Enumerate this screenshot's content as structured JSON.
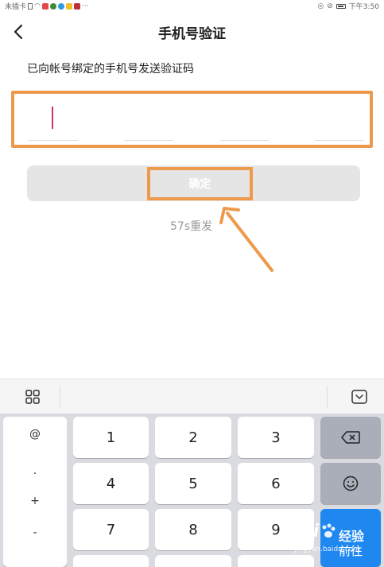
{
  "status_bar": {
    "left_text": "未插卡",
    "right_time": "下午3:50"
  },
  "nav": {
    "title": "手机号验证",
    "back_icon": "chevron-left-icon"
  },
  "hint": "已向帐号绑定的手机号发送验证码",
  "confirm_label": "确定",
  "resend_label": "57s重发",
  "keyboard": {
    "toolbar_icons": [
      "grid-icon",
      "keyboard-hide-icon"
    ],
    "symbols": [
      "@",
      ".",
      "+",
      "-"
    ],
    "digits": [
      "1",
      "2",
      "3",
      "4",
      "5",
      "6",
      "7",
      "8",
      "9"
    ],
    "side_keys": [
      "backspace-icon",
      "emoji-icon"
    ],
    "next_label": "前往"
  },
  "watermark": {
    "brand": "Bai",
    "cn": "经验",
    "url": "jingyan.baidu.com"
  },
  "colors": {
    "annotation": "#ee9a4d",
    "cursor": "#c9356f",
    "accent_key": "#1e87f0"
  }
}
